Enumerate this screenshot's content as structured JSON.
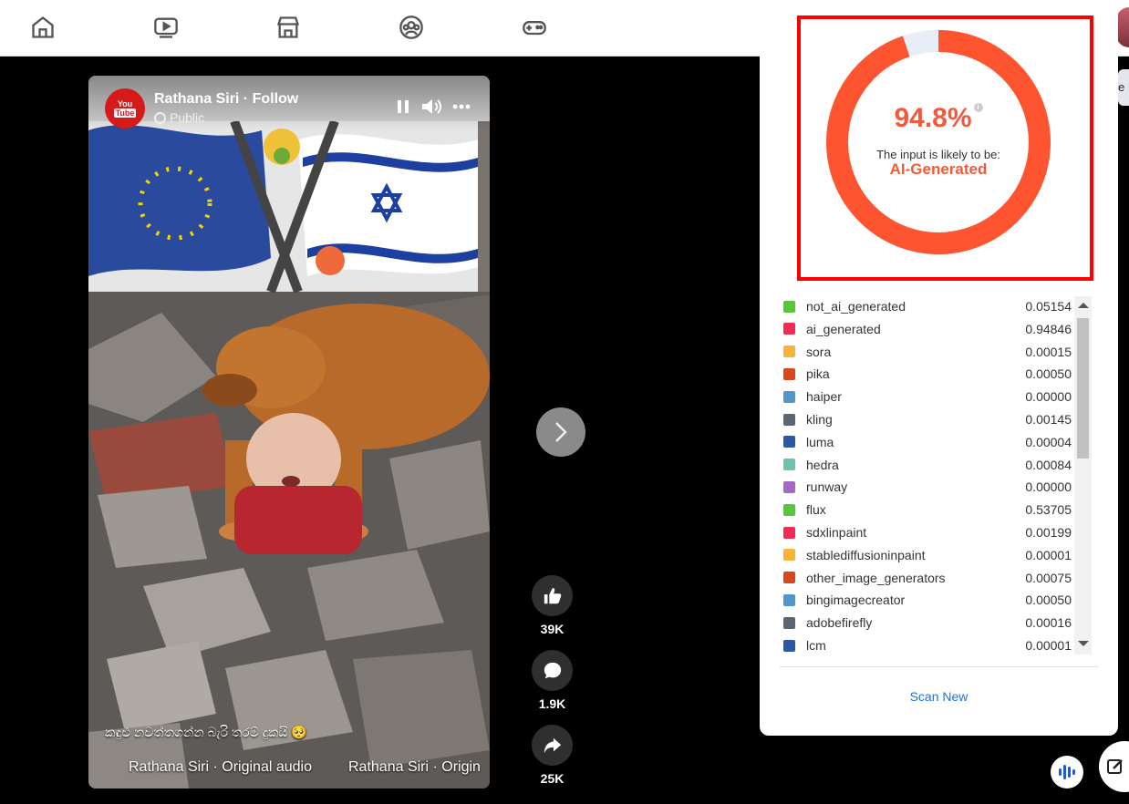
{
  "nav": {
    "icons": [
      "home-icon",
      "video-icon",
      "marketplace-icon",
      "groups-icon",
      "gaming-icon"
    ]
  },
  "video": {
    "channel_name": "Rathana Siri · Follow",
    "privacy": "Public",
    "logo_text_top": "You",
    "logo_text_bottom": "Tube",
    "caption": "කඳුළු නවත්තගන්න බැරි තරම් දුකයි 🥺",
    "audio_1": "Rathana Siri · Original audio",
    "audio_2": "Rathana Siri · Origin"
  },
  "actions": {
    "likes": "39K",
    "comments": "1.9K",
    "shares": "25K"
  },
  "detector": {
    "percentage": "94.8%",
    "percentage_value": 0.948,
    "likely_label": "The input is likely to be:",
    "verdict": "AI-Generated",
    "ring_color": "#fe5530",
    "ring_bg_color": "#e8eef7",
    "rows": [
      {
        "label": "not_ai_generated",
        "value": "0.05154",
        "color": "#5ac43a"
      },
      {
        "label": "ai_generated",
        "value": "0.94846",
        "color": "#ee2d55"
      },
      {
        "label": "sora",
        "value": "0.00015",
        "color": "#f7b33a"
      },
      {
        "label": "pika",
        "value": "0.00050",
        "color": "#d9481c"
      },
      {
        "label": "haiper",
        "value": "0.00000",
        "color": "#4f97cf"
      },
      {
        "label": "kling",
        "value": "0.00145",
        "color": "#5b6670"
      },
      {
        "label": "luma",
        "value": "0.00004",
        "color": "#2c57a4"
      },
      {
        "label": "hedra",
        "value": "0.00084",
        "color": "#6fc2b0"
      },
      {
        "label": "runway",
        "value": "0.00000",
        "color": "#a469c4"
      },
      {
        "label": "flux",
        "value": "0.53705",
        "color": "#5ac43a"
      },
      {
        "label": "sdxlinpaint",
        "value": "0.00199",
        "color": "#ee2d55"
      },
      {
        "label": "stablediffusioninpaint",
        "value": "0.00001",
        "color": "#f7b33a"
      },
      {
        "label": "other_image_generators",
        "value": "0.00075",
        "color": "#d9481c"
      },
      {
        "label": "bingimagecreator",
        "value": "0.00050",
        "color": "#4f97cf"
      },
      {
        "label": "adobefirefly",
        "value": "0.00016",
        "color": "#5b6670"
      },
      {
        "label": "lcm",
        "value": "0.00001",
        "color": "#2c57a4"
      }
    ],
    "scan_new": "Scan New"
  },
  "side_peek": "e"
}
